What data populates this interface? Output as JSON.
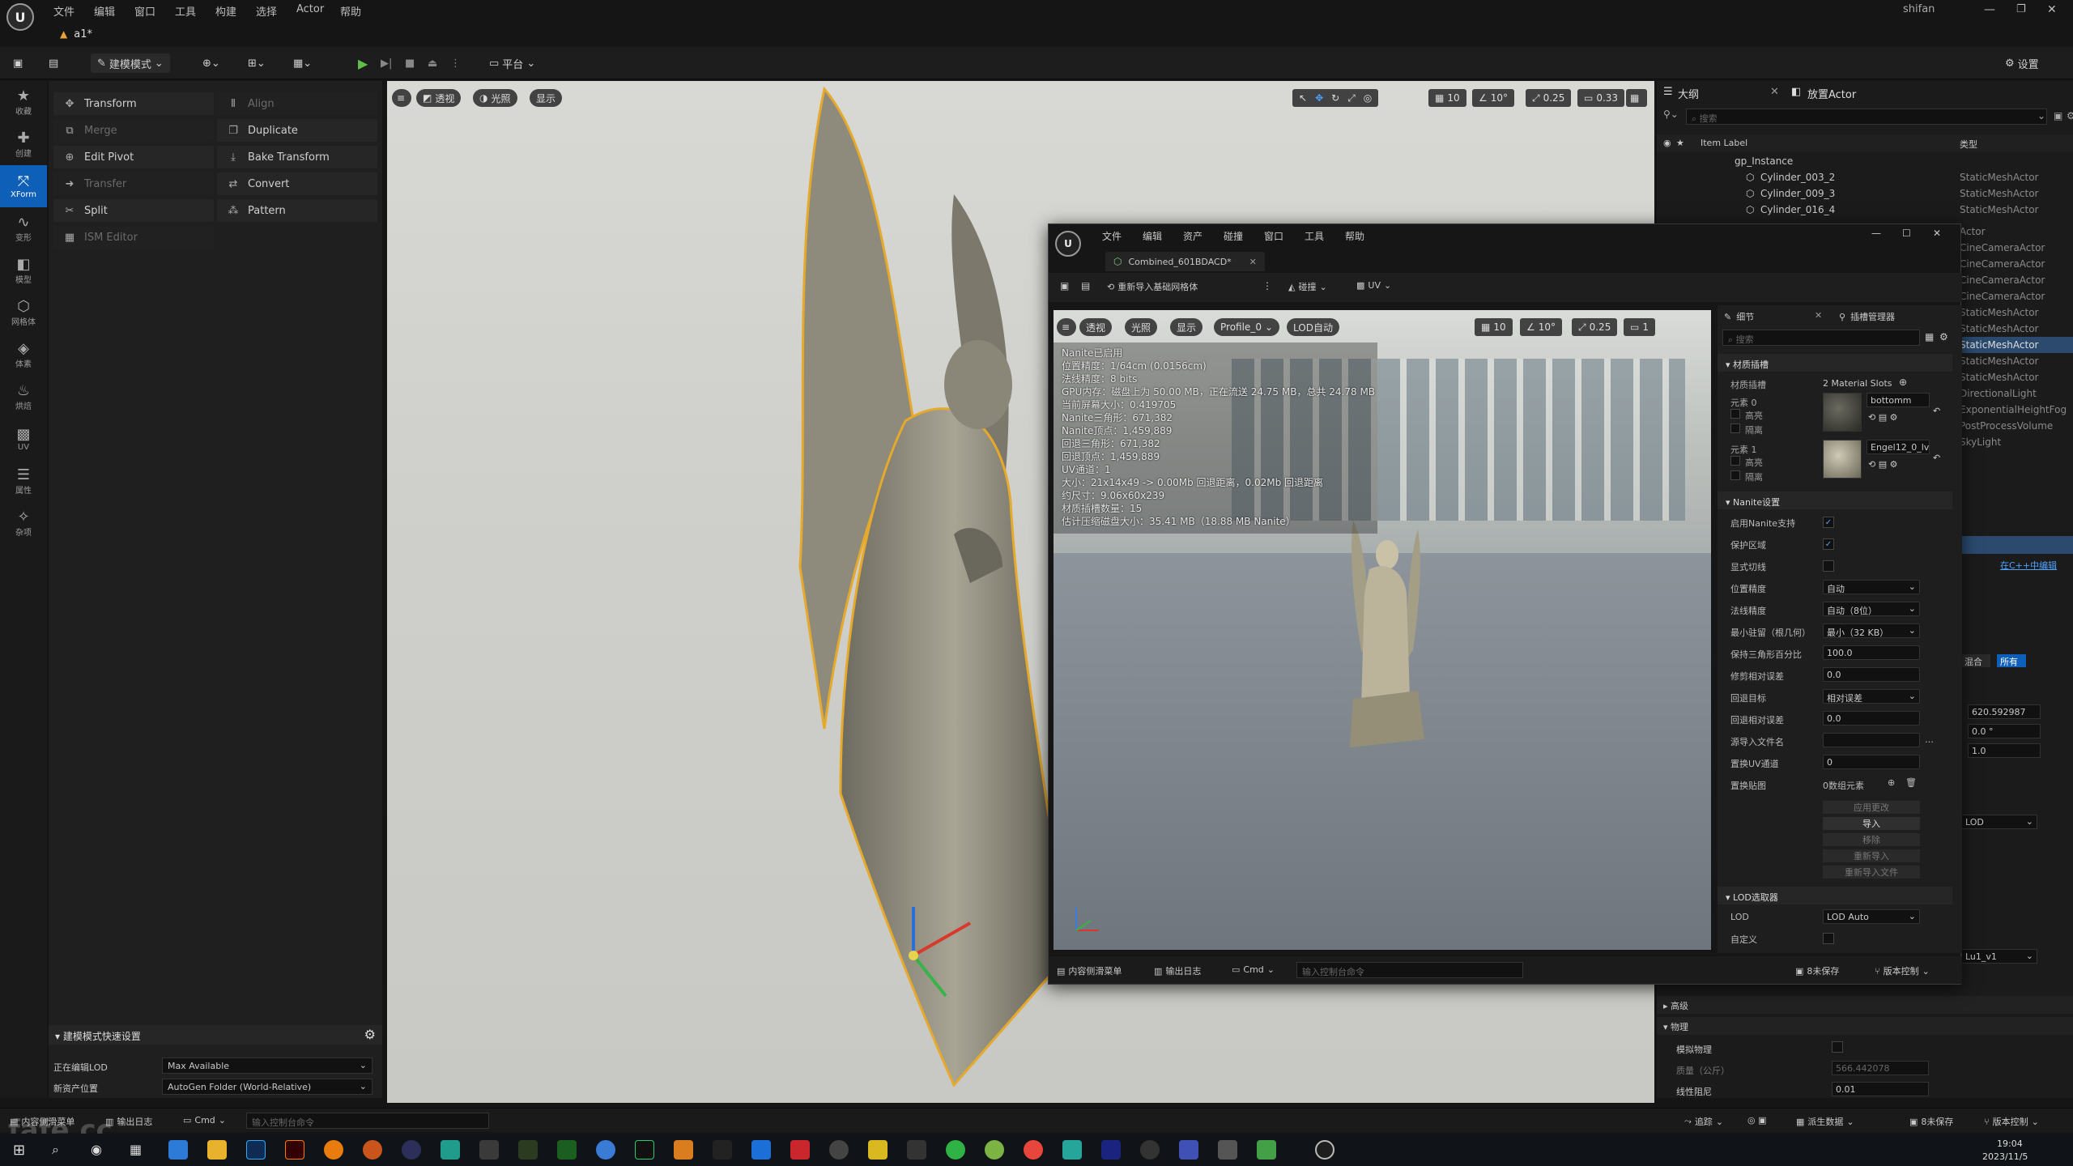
{
  "menu": {
    "items": [
      "文件",
      "编辑",
      "窗口",
      "工具",
      "构建",
      "选择",
      "Actor",
      "帮助"
    ],
    "user": "shifan"
  },
  "project_tab": "a1*",
  "toolbar": {
    "mode": "建模模式",
    "platform": "平台",
    "settings": "设置"
  },
  "left_strip": [
    {
      "label": "收藏",
      "icon": "star-icon"
    },
    {
      "label": "创建",
      "icon": "create-icon"
    },
    {
      "label": "XForm",
      "icon": "xform-icon",
      "active": true
    },
    {
      "label": "变形",
      "icon": "deform-icon"
    },
    {
      "label": "模型",
      "icon": "model-icon"
    },
    {
      "label": "网格体",
      "icon": "mesh-icon"
    },
    {
      "label": "体素",
      "icon": "voxel-icon"
    },
    {
      "label": "烘焙",
      "icon": "bake-icon"
    },
    {
      "label": "UV",
      "icon": "uv-icon"
    },
    {
      "label": "属性",
      "icon": "attributes-icon"
    },
    {
      "label": "杂项",
      "icon": "misc-icon"
    }
  ],
  "tools": {
    "left": [
      {
        "label": "Transform",
        "enabled": true
      },
      {
        "label": "Merge",
        "enabled": false
      },
      {
        "label": "Edit Pivot",
        "enabled": true
      },
      {
        "label": "Transfer",
        "enabled": false
      },
      {
        "label": "Split",
        "enabled": true
      },
      {
        "label": "ISM Editor",
        "enabled": false
      }
    ],
    "right": [
      {
        "label": "Align",
        "enabled": false
      },
      {
        "label": "Duplicate",
        "enabled": true
      },
      {
        "label": "Bake Transform",
        "enabled": true
      },
      {
        "label": "Convert",
        "enabled": true
      },
      {
        "label": "Pattern",
        "enabled": true
      }
    ],
    "quick_settings": {
      "title": "建模模式快速设置",
      "lod_label": "正在编辑LOD",
      "lod_value": "Max Available",
      "asset_label": "新资产位置",
      "asset_value": "AutoGen Folder (World-Relative)"
    }
  },
  "viewport": {
    "buttons": [
      "透视",
      "光照",
      "显示"
    ],
    "snap": {
      "grid": "10",
      "angle": "10°",
      "scale": "0.25",
      "cam": "0.33"
    }
  },
  "outliner": {
    "tab1": "大纲",
    "tab2": "放置Actor",
    "search_placeholder": "搜索",
    "col_label": "Item Label",
    "col_type": "类型",
    "rows": [
      {
        "name": "gp_Instance",
        "type": "",
        "indent": 1
      },
      {
        "name": "Cylinder_003_2",
        "type": "StaticMeshActor",
        "indent": 2
      },
      {
        "name": "Cylinder_009_3",
        "type": "StaticMeshActor",
        "indent": 2
      },
      {
        "name": "Cylinder_016_4",
        "type": "StaticMeshActor",
        "indent": 2
      }
    ],
    "hidden_types": [
      "Actor",
      "CineCameraActor",
      "CineCameraActor",
      "CineCameraActor",
      "CineCameraActor",
      "StaticMeshActor",
      "StaticMeshActor",
      "StaticMeshActor",
      "StaticMeshActor",
      "StaticMeshActor",
      "DirectionalLight",
      "ExponentialHeightFog",
      "PostProcessVolume",
      "SkyLight"
    ],
    "edit_link": "在C++中编辑",
    "side_values": [
      "620.592987",
      "0.0 °",
      "1.0"
    ],
    "tabs_small": [
      "混合",
      "所有"
    ],
    "lod_small": "LOD",
    "uv_small": "Lu1_v1",
    "sections": [
      "高级",
      "物理"
    ],
    "physics_label": "模拟物理",
    "mass_label": "质量（公斤）",
    "mass_value": "566.442078",
    "damping_label": "线性阻尼",
    "damping_value": "0.01"
  },
  "mesh_editor": {
    "menu": [
      "文件",
      "编辑",
      "资产",
      "碰撞",
      "窗口",
      "工具",
      "帮助"
    ],
    "tab": "Combined_601BDACD*",
    "toolbar": {
      "reimport": "重新导入基础网格体",
      "collision": "碰撞",
      "uv": "UV"
    },
    "vp_buttons": [
      "透视",
      "光照",
      "显示",
      "Profile_0",
      "LOD自动"
    ],
    "snap": {
      "grid": "10",
      "angle": "10°",
      "scale": "0.25",
      "cam": "1"
    },
    "stats": [
      "Nanite已启用",
      "位置精度：1/64cm (0.0156cm)",
      "法线精度：8 bits",
      "GPU内存：磁盘上为 50.00 MB，正在流送 24.75 MB，总共 24.78 MB",
      "当前屏幕大小：0.419705",
      "Nanite三角形：671,382",
      "Nanite顶点：1,459,889",
      "回退三角形：671,382",
      "回退顶点：1,459,889",
      "UV通道：1",
      "大小：21x14x49 -> 0.00Mb 回退距离，0.02Mb 回退距离",
      "约尺寸：9.06x60x239",
      "材质插槽数量：15",
      "估计压缩磁盘大小：35.41 MB（18.88 MB Nanite）"
    ],
    "details": {
      "tab": "细节",
      "tab2": "插槽管理器",
      "search": "搜索",
      "material_section": "材质插槽",
      "material_label": "材质插槽",
      "material_slots": "2 Material Slots",
      "element0": "元素 0",
      "element1": "元素 1",
      "mat0": "bottomm",
      "mat1": "Engel12_0_lv",
      "highlight": "高亮",
      "isolate": "隔离",
      "nanite_section": "Nanite设置",
      "nanite_rows": [
        {
          "label": "启用Nanite支持",
          "kind": "check",
          "value": "✓"
        },
        {
          "label": "保护区域",
          "kind": "check",
          "value": "✓"
        },
        {
          "label": "显式切线",
          "kind": "check",
          "value": ""
        },
        {
          "label": "位置精度",
          "kind": "select",
          "value": "自动"
        },
        {
          "label": "法线精度",
          "kind": "select",
          "value": "自动（8位）"
        },
        {
          "label": "最小驻留（根几何）",
          "kind": "select",
          "value": "最小（32 KB）"
        },
        {
          "label": "保持三角形百分比",
          "kind": "field",
          "value": "100.0"
        },
        {
          "label": "修剪相对误差",
          "kind": "field",
          "value": "0.0"
        },
        {
          "label": "回退目标",
          "kind": "select",
          "value": "相对误差"
        },
        {
          "label": "回退相对误差",
          "kind": "field",
          "value": "0.0"
        },
        {
          "label": "源导入文件名",
          "kind": "field",
          "value": ""
        },
        {
          "label": "置换UV通道",
          "kind": "field",
          "value": "0"
        },
        {
          "label": "置换贴图",
          "kind": "text",
          "value": "0数组元素"
        }
      ],
      "buttons": [
        "应用更改",
        "导入",
        "移除",
        "重新导入",
        "重新导入文件"
      ],
      "lod_section": "LOD选取器",
      "lod_label": "LOD",
      "lod_value": "LOD Auto",
      "custom_label": "自定义"
    },
    "bottom": {
      "drawer": "内容侧滑菜单",
      "log": "输出日志",
      "cmd": "Cmd",
      "cmd_placeholder": "输入控制台命令",
      "unsaved": "8未保存",
      "vcs": "版本控制"
    }
  },
  "bottombar": {
    "drawer": "内容侧滑菜单",
    "log": "输出日志",
    "cmd": "Cmd",
    "cmd_placeholder": "输入控制台命令",
    "trace": "追踪",
    "derived": "派生数据",
    "unsaved": "8未保存",
    "vcs": "版本控制"
  },
  "watermark": "fafe.cc",
  "taskbar": {
    "time": "19:04",
    "date": "2023/11/5"
  }
}
